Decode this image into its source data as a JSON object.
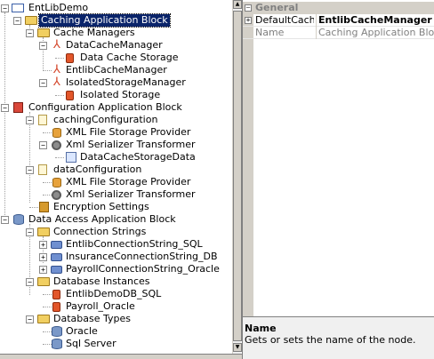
{
  "tree": {
    "root": "EntLibDemo",
    "caching_block": "Caching Application Block",
    "cache_managers": "Cache Managers",
    "data_cache_manager": "DataCacheManager",
    "data_cache_storage": "Data Cache Storage",
    "entlib_cache_manager": "EntlibCacheManager",
    "isolated_storage_manager": "IsolatedStorageManager",
    "isolated_storage": "Isolated Storage",
    "configuration_block": "Configuration Application Block",
    "caching_configuration": "cachingConfiguration",
    "xml_file_storage_provider_1": "XML File Storage Provider",
    "xml_serializer_transformer_1": "Xml Serializer Transformer",
    "data_cache_storage_data": "DataCacheStorageData",
    "data_configuration": "dataConfiguration",
    "xml_file_storage_provider_2": "XML File Storage Provider",
    "xml_serializer_transformer_2": "Xml Serializer Transformer",
    "encryption_settings": "Encryption Settings",
    "data_access_block": "Data Access Application Block",
    "connection_strings": "Connection Strings",
    "conn_sql": "EntlibConnectionString_SQL",
    "conn_insurance": "InsuranceConnectionString_DB",
    "conn_payroll": "PayrollConnectionString_Oracle",
    "database_instances": "Database Instances",
    "db_sql": "EntlibDemoDB_SQL",
    "db_oracle": "Payroll_Oracle",
    "database_types": "Database Types",
    "type_oracle": "Oracle",
    "type_sql": "Sql Server"
  },
  "properties": {
    "category": "General",
    "default_cache_name": "DefaultCacheI",
    "default_cache_value": "EntlibCacheManager",
    "name_label": "Name",
    "name_value": "Caching Application Block"
  },
  "help": {
    "title": "Name",
    "description": "Gets or sets the name of the node."
  }
}
